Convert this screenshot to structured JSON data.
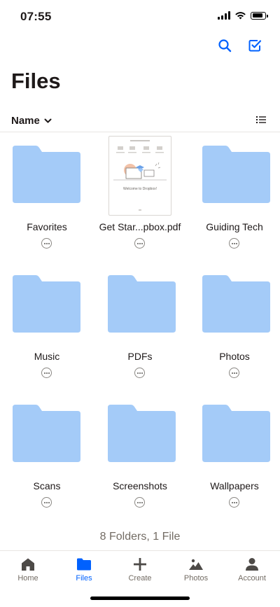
{
  "status_bar": {
    "time": "07:55"
  },
  "header": {
    "title": "Files"
  },
  "sort": {
    "label": "Name"
  },
  "items": [
    {
      "name": "Favorites",
      "kind": "folder"
    },
    {
      "name": "Get Star...pbox.pdf",
      "kind": "file"
    },
    {
      "name": "Guiding Tech",
      "kind": "folder"
    },
    {
      "name": "Music",
      "kind": "folder"
    },
    {
      "name": "PDFs",
      "kind": "folder"
    },
    {
      "name": "Photos",
      "kind": "folder"
    },
    {
      "name": "Scans",
      "kind": "folder"
    },
    {
      "name": "Screenshots",
      "kind": "folder"
    },
    {
      "name": "Wallpapers",
      "kind": "folder"
    }
  ],
  "pdf_preview": {
    "caption": "Welcome to Dropbox!"
  },
  "summary": "8 Folders, 1 File",
  "tabs": [
    {
      "label": "Home",
      "icon": "home-icon"
    },
    {
      "label": "Files",
      "icon": "folder-icon"
    },
    {
      "label": "Create",
      "icon": "plus-icon"
    },
    {
      "label": "Photos",
      "icon": "photos-icon"
    },
    {
      "label": "Account",
      "icon": "person-icon"
    }
  ],
  "colors": {
    "accent": "#0061fe",
    "folder": "#a4cbf8",
    "folder_tab": "#9bc4f6",
    "text": "#1e1919",
    "muted": "#736c64"
  }
}
